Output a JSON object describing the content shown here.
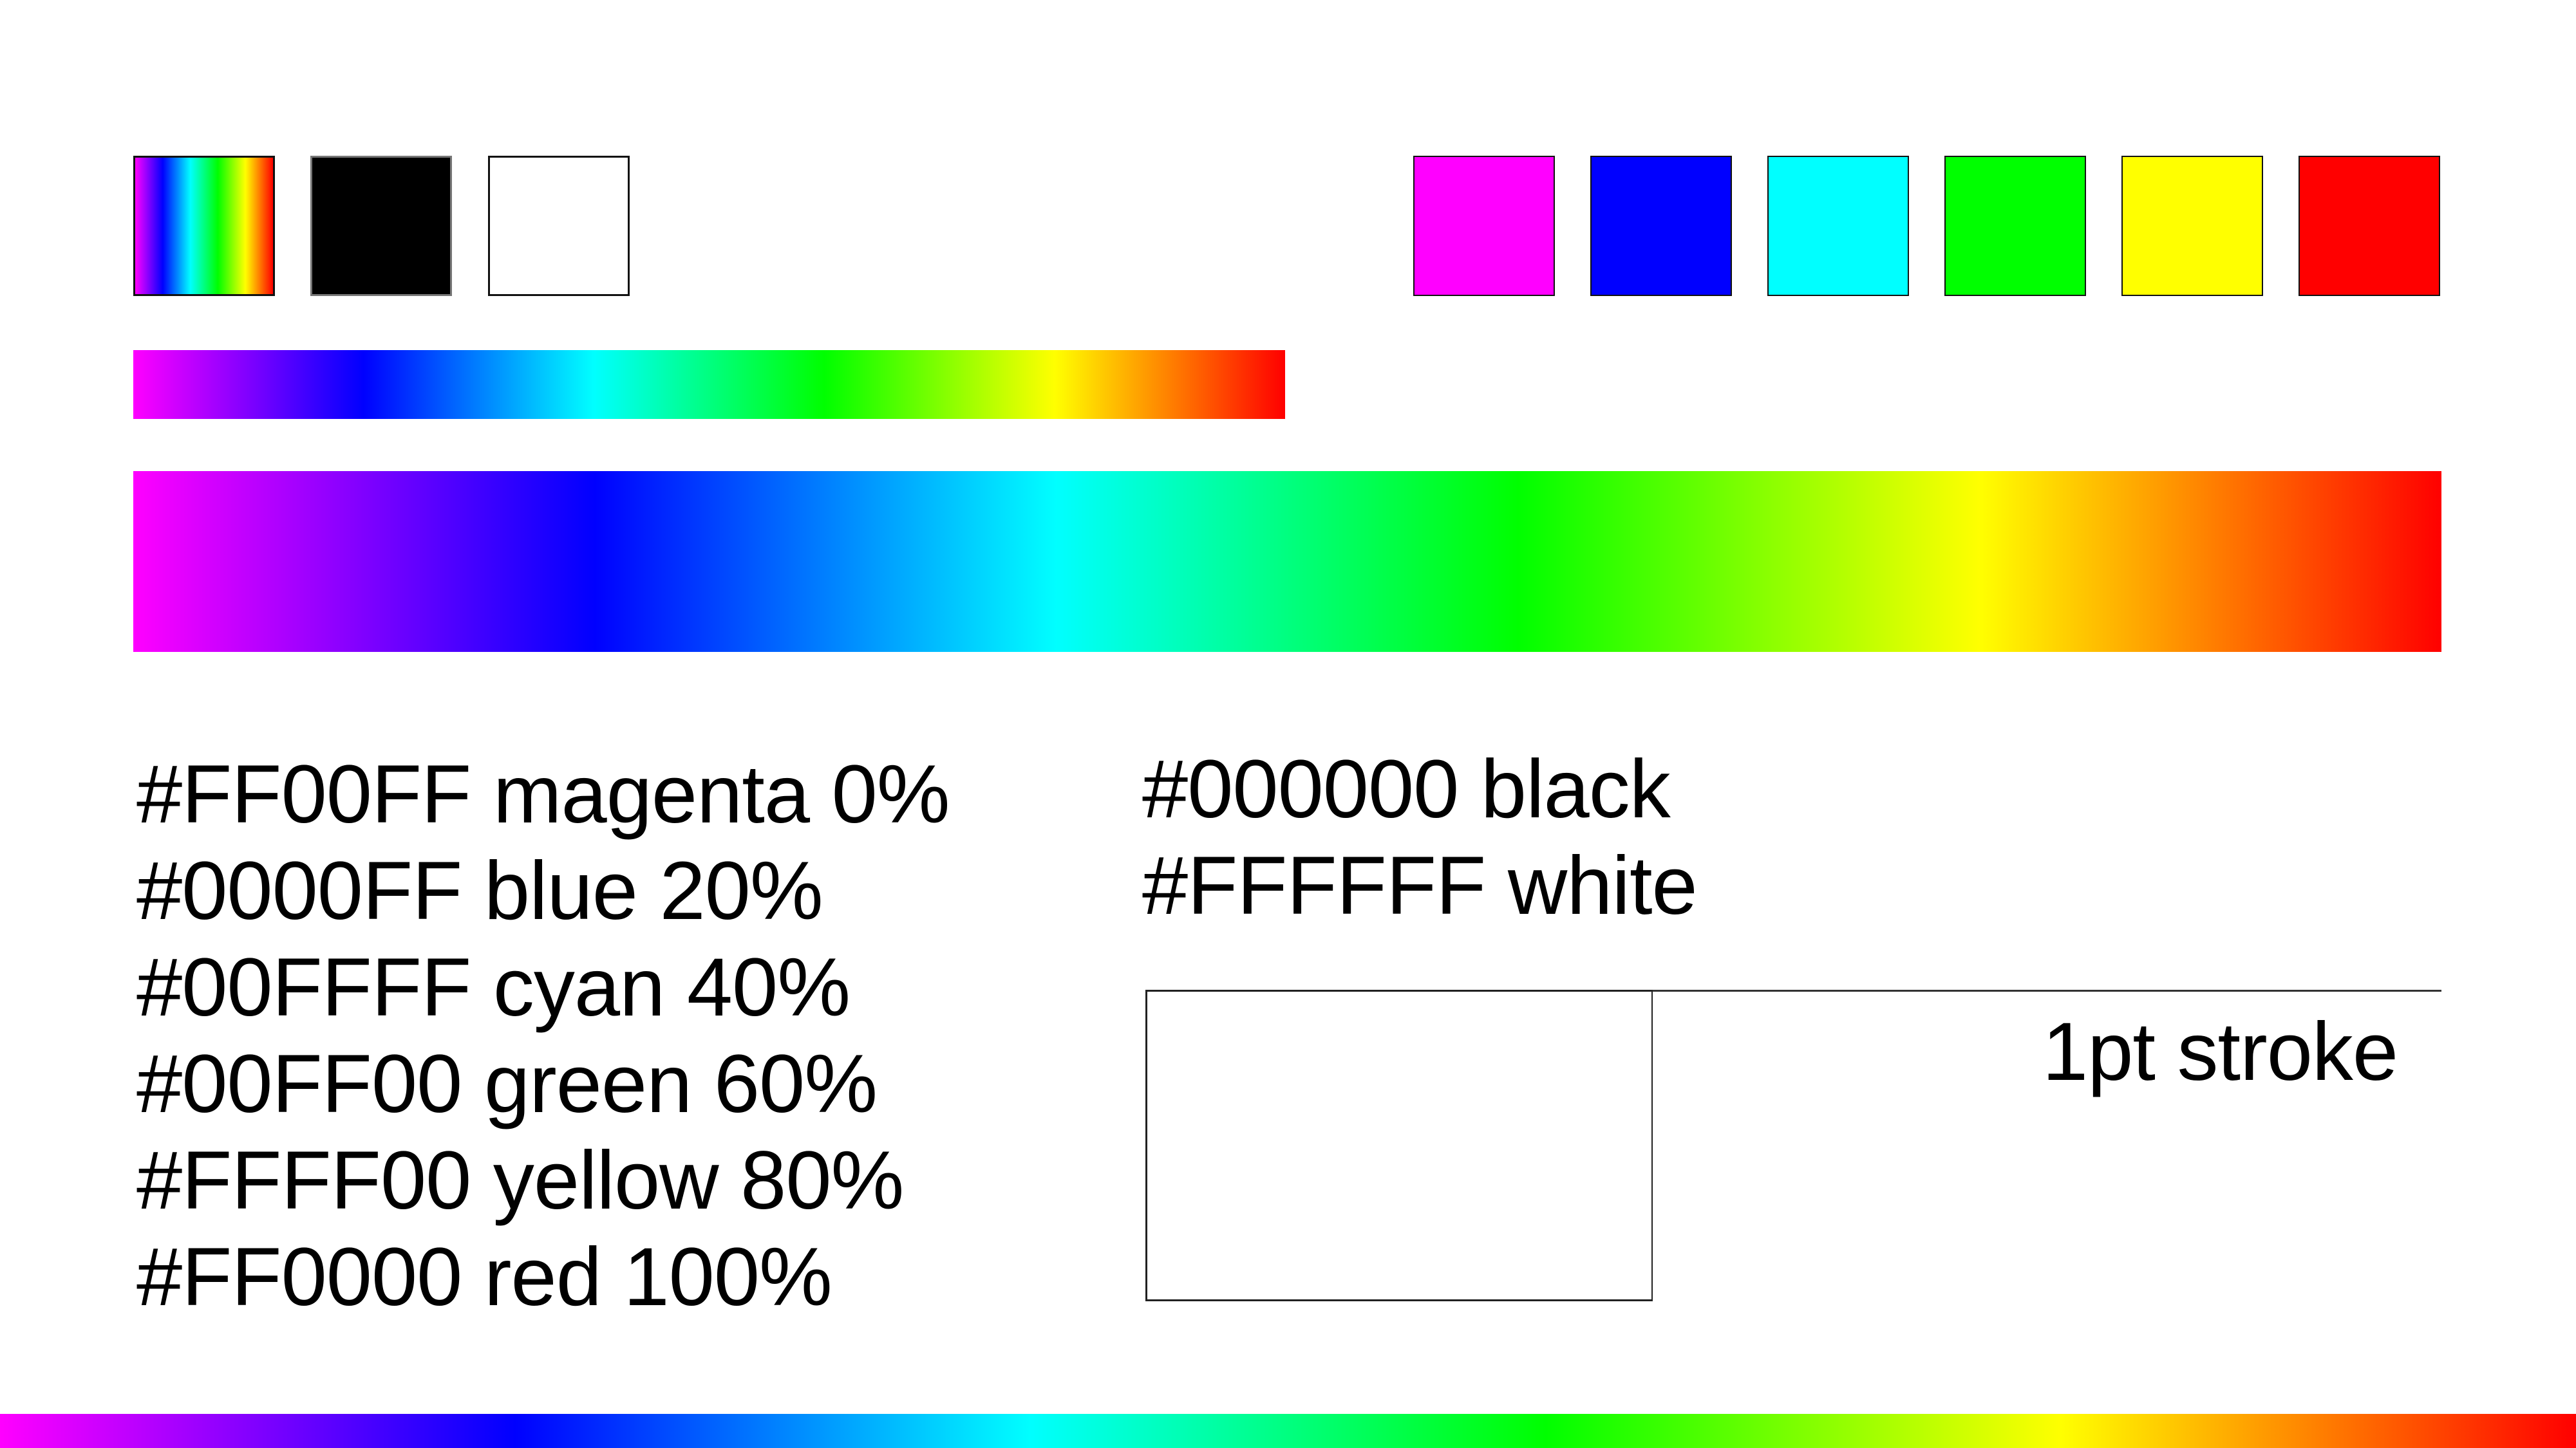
{
  "swatches_left": [
    {
      "name": "spectrum",
      "fill": "gradient"
    },
    {
      "name": "black",
      "fill": "#000000"
    },
    {
      "name": "white",
      "fill": "#FFFFFF"
    }
  ],
  "swatches_right": [
    "#FF00FF",
    "#0000FF",
    "#00FFFF",
    "#00FF00",
    "#FFFF00",
    "#FF0000"
  ],
  "gradient_stops": [
    {
      "hex": "#FF00FF",
      "percent": 0
    },
    {
      "hex": "#0000FF",
      "percent": 20
    },
    {
      "hex": "#00FFFF",
      "percent": 40
    },
    {
      "hex": "#00FF00",
      "percent": 60
    },
    {
      "hex": "#FFFF00",
      "percent": 80
    },
    {
      "hex": "#FF0000",
      "percent": 100
    }
  ],
  "labels_left": [
    "#FF00FF magenta 0%",
    "#0000FF blue 20%",
    "#00FFFF cyan 40%",
    "#00FF00 green 60%",
    "#FFFF00 yellow 80%",
    "#FF0000 red 100%"
  ],
  "labels_right": [
    "#000000 black",
    "#FFFFFF white"
  ],
  "stroke_label": "1pt stroke"
}
